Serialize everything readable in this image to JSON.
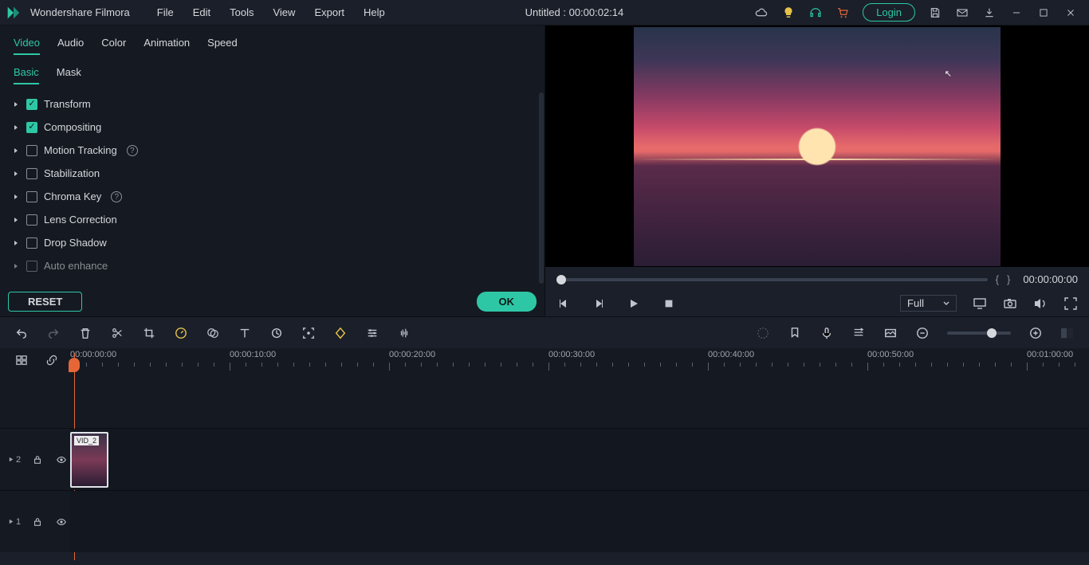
{
  "app": {
    "name": "Wondershare Filmora",
    "title_center": "Untitled : 00:00:02:14"
  },
  "menu": {
    "items": [
      "File",
      "Edit",
      "Tools",
      "View",
      "Export",
      "Help"
    ]
  },
  "header": {
    "login_label": "Login"
  },
  "prop_tabs": {
    "items": [
      "Video",
      "Audio",
      "Color",
      "Animation",
      "Speed"
    ],
    "active": 0
  },
  "sub_tabs": {
    "items": [
      "Basic",
      "Mask"
    ],
    "active": 0
  },
  "properties": [
    {
      "label": "Transform",
      "checked": true,
      "help": false
    },
    {
      "label": "Compositing",
      "checked": true,
      "help": false
    },
    {
      "label": "Motion Tracking",
      "checked": false,
      "help": true
    },
    {
      "label": "Stabilization",
      "checked": false,
      "help": false
    },
    {
      "label": "Chroma Key",
      "checked": false,
      "help": true
    },
    {
      "label": "Lens Correction",
      "checked": false,
      "help": false
    },
    {
      "label": "Drop Shadow",
      "checked": false,
      "help": false
    },
    {
      "label": "Auto enhance",
      "checked": false,
      "help": false
    }
  ],
  "panel_buttons": {
    "reset": "RESET",
    "ok": "OK"
  },
  "preview": {
    "timecode": "00:00:00:00",
    "quality": "Full"
  },
  "ruler": {
    "labels": [
      "00:00:00:00",
      "00:00:10:00",
      "00:00:20:00",
      "00:00:30:00",
      "00:00:40:00",
      "00:00:50:00",
      "00:01:00:00"
    ],
    "spacing_px": 200
  },
  "tracks": {
    "track2": {
      "index": "2"
    },
    "track1": {
      "index": "1"
    },
    "clip_label": "VID_2"
  }
}
